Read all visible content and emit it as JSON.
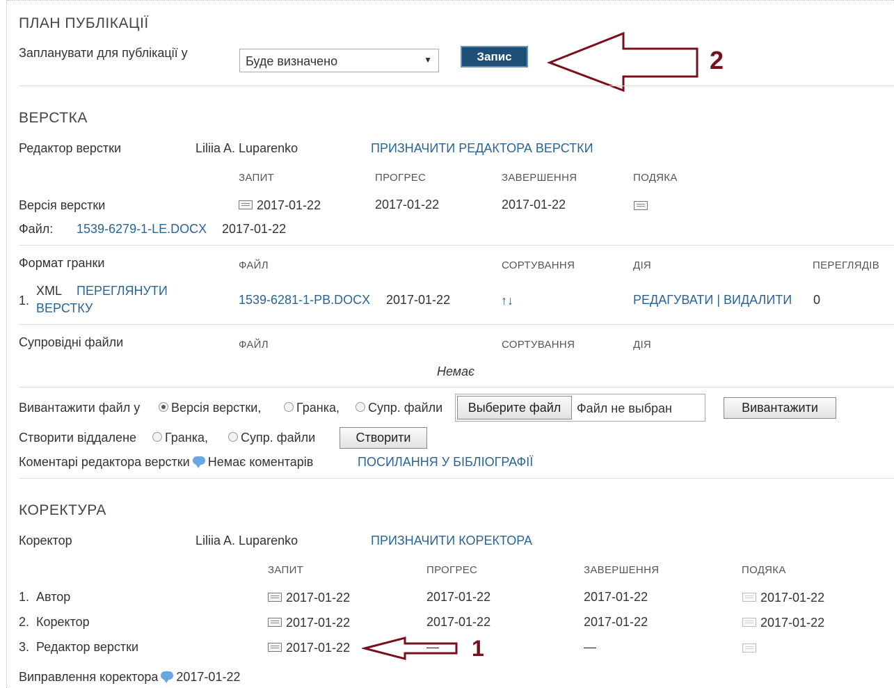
{
  "publication_plan": {
    "heading": "ПЛАН ПУБЛІКАЦІЇ",
    "schedule_label": "Запланувати для публікації у",
    "schedule_select": "Буде визначено",
    "save_button": "Запис",
    "annotation_number": "2"
  },
  "layout": {
    "heading": "ВЕРСТКА",
    "editor_label": "Редактор верстки",
    "editor_name": "Liliia A. Luparenko",
    "assign_editor_link": "ПРИЗНАЧИТИ РЕДАКТОРА ВЕРСТКИ",
    "columns": {
      "request": "ЗАПИТ",
      "progress": "ПРОГРЕС",
      "completion": "ЗАВЕРШЕННЯ",
      "thanks": "ПОДЯКА"
    },
    "version_label": "Версія верстки",
    "version_request": "2017-01-22",
    "version_progress": "2017-01-22",
    "version_completion": "2017-01-22",
    "file_label": "Файл:",
    "file_link": "1539-6279-1-LE.DOCX",
    "file_date": "2017-01-22",
    "galley": {
      "label": "Формат гранки",
      "col_file": "ФАЙЛ",
      "col_sort": "СОРТУВАННЯ",
      "col_action": "ДІЯ",
      "col_views": "ПЕРЕГЛЯДІВ",
      "row_num": "1.",
      "row_format": "XML",
      "row_view_link_1": "ПЕРЕГЛЯНУТИ",
      "row_view_link_2": "ВЕРСТКУ",
      "row_file": "1539-6281-1-PB.DOCX",
      "row_date": "2017-01-22",
      "row_sort": "↑↓",
      "row_edit_delete": "РЕДАГУВАТИ | ВИДАЛИТИ",
      "row_views": "0"
    },
    "supp": {
      "label": "Супровідні файли",
      "col_file": "ФАЙЛ",
      "col_sort": "СОРТУВАННЯ",
      "col_action": "ДІЯ",
      "empty": "Немає"
    },
    "upload": {
      "label": "Вивантажити файл у",
      "opt_version": "Версія верстки,",
      "opt_galley": "Гранка,",
      "opt_supp": "Супр. файли",
      "choose_button": "Выберите файл",
      "no_file": "Файл не выбран",
      "upload_button": "Вивантажити"
    },
    "create_remote": {
      "label": "Створити віддалене",
      "opt_galley": "Гранка,",
      "opt_supp": "Супр. файли",
      "create_button": "Створити"
    },
    "comments_label": "Коментарі редактора верстки",
    "comments_value": "Немає коментарів",
    "references_link": "ПОСИЛАННЯ У БІБЛІОГРАФІЇ"
  },
  "proofreading": {
    "heading": "КОРЕКТУРА",
    "proofreader_label": "Коректор",
    "proofreader_name": "Liliia A. Luparenko",
    "assign_link": "ПРИЗНАЧИТИ КОРЕКТОРА",
    "columns": {
      "request": "ЗАПИТ",
      "progress": "ПРОГРЕС",
      "completion": "ЗАВЕРШЕННЯ",
      "thanks": "ПОДЯКА"
    },
    "rows": [
      {
        "num": "1.",
        "role": "Автор",
        "request": "2017-01-22",
        "progress": "2017-01-22",
        "completion": "2017-01-22",
        "thanks": "2017-01-22"
      },
      {
        "num": "2.",
        "role": "Коректор",
        "request": "2017-01-22",
        "progress": "2017-01-22",
        "completion": "2017-01-22",
        "thanks": "2017-01-22"
      },
      {
        "num": "3.",
        "role": "Редактор верстки",
        "request": "2017-01-22",
        "progress": "—",
        "completion": "—",
        "thanks": ""
      }
    ],
    "corrections_label": "Виправлення коректора",
    "corrections_date": "2017-01-22",
    "annotation_number": "1"
  }
}
